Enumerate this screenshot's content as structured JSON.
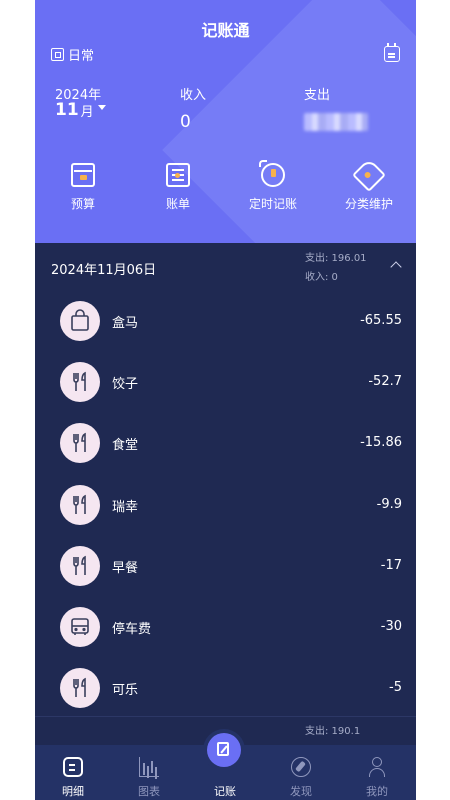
{
  "header": {
    "title": "记账通",
    "book_name": "日常",
    "year": "2024年",
    "month": "11",
    "month_unit": "月",
    "income_label": "收入",
    "income_value": "0",
    "expense_label": "支出"
  },
  "quick_actions": [
    {
      "label": "预算",
      "icon": "budget-icon"
    },
    {
      "label": "账单",
      "icon": "bill-icon"
    },
    {
      "label": "定时记账",
      "icon": "alarm-clock-icon"
    },
    {
      "label": "分类维护",
      "icon": "tag-icon"
    }
  ],
  "day_group": {
    "date": "2024年11月06日",
    "expense_summary": "支出: 196.01",
    "income_summary": "收入: 0",
    "items": [
      {
        "name": "盒马",
        "amount": "-65.55",
        "icon": "shopping-bag-icon"
      },
      {
        "name": "饺子",
        "amount": "-52.7",
        "icon": "fork-knife-icon"
      },
      {
        "name": "食堂",
        "amount": "-15.86",
        "icon": "fork-knife-icon"
      },
      {
        "name": "瑞幸",
        "amount": "-9.9",
        "icon": "fork-knife-icon"
      },
      {
        "name": "早餐",
        "amount": "-17",
        "icon": "fork-knife-icon"
      },
      {
        "name": "停车费",
        "amount": "-30",
        "icon": "bus-icon"
      },
      {
        "name": "可乐",
        "amount": "-5",
        "icon": "fork-knife-icon"
      }
    ]
  },
  "next_group": {
    "expense_summary": "支出: 190.1"
  },
  "tabbar": {
    "items": [
      {
        "label": "明细",
        "active": true
      },
      {
        "label": "图表"
      },
      {
        "label": "记账"
      },
      {
        "label": "发现"
      },
      {
        "label": "我的"
      }
    ]
  },
  "colors": {
    "header_bg": "#6a6ff4",
    "list_bg": "#1f2952",
    "tabbar_bg": "#243266",
    "accent": "#f7b24c",
    "avatar_bg": "#f5e6f1"
  }
}
